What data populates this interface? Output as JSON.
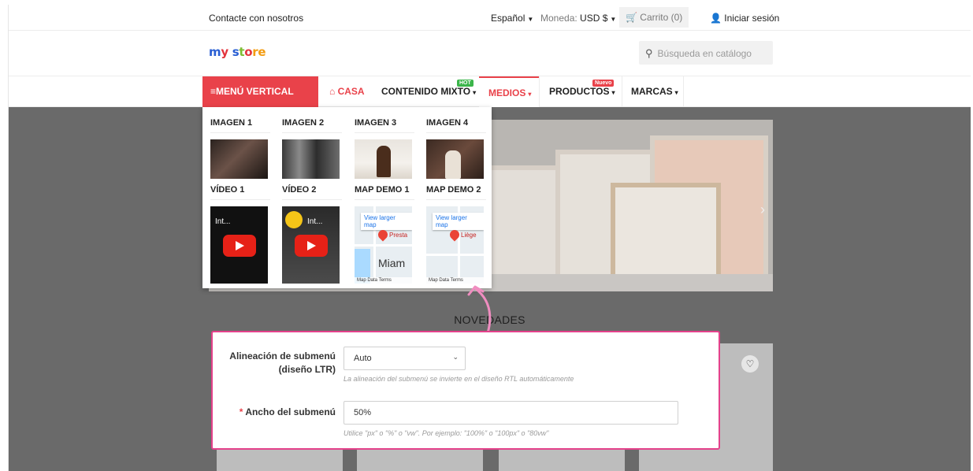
{
  "topbar": {
    "contact": "Contacte con nosotros",
    "language": "Español",
    "currency_label": "Moneda:",
    "currency_value": "USD $",
    "cart": "Carrito (0)",
    "signin": "Iniciar sesión"
  },
  "header": {
    "logo": [
      "m",
      "y ",
      "s",
      "t",
      "o",
      "re"
    ],
    "search_placeholder": "Búsqueda en catálogo"
  },
  "nav": {
    "vertical": "MENÚ VERTICAL",
    "casa": "CASA",
    "mixto": "CONTENIDO MIXTO",
    "medios": "MEDIOS",
    "productos": "PRODUCTOS",
    "marcas": "MARCAS",
    "badge_hot": "HOT",
    "badge_nuevo": "Nuevo"
  },
  "dropdown": {
    "images": [
      "IMAGEN 1",
      "IMAGEN 2",
      "IMAGEN 3",
      "IMAGEN 4"
    ],
    "videos": [
      "VÍDEO 1",
      "VÍDEO 2"
    ],
    "video_titles": [
      "Int...",
      "Int..."
    ],
    "maps": [
      "MAP DEMO 1",
      "MAP DEMO 2"
    ],
    "map_link": "View larger map",
    "map_places": [
      "Presta",
      "Liège"
    ],
    "map_city": "Miam",
    "map_footer": "Map Data  Terms"
  },
  "main": {
    "section_title": "NOVEDADES"
  },
  "settings": {
    "align_label": "Alineación de submenú (diseño LTR)",
    "align_value": "Auto",
    "align_help": "La alineación del submenú se invierte en el diseño RTL automáticamente",
    "width_required": "*",
    "width_label": "Ancho del submenú",
    "width_value": "50%",
    "width_help": "Utilice \"px\" o \"%\" o \"vw\". Por ejemplo: \"100%\" o \"100px\" o \"80vw\""
  },
  "colors": {
    "accent": "#e9424a",
    "panel_border": "#e4418b",
    "hot_badge": "#3bb54a"
  }
}
